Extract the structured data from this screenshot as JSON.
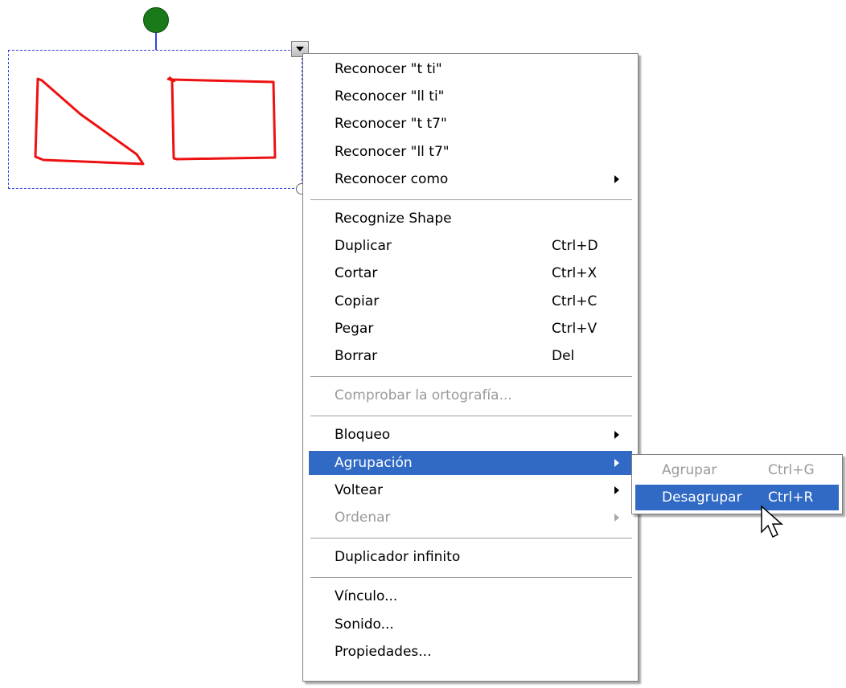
{
  "colors": {
    "highlight": "#316ac5",
    "disabled_text": "#9a9a9a",
    "ink_red": "#ee1111",
    "rotate_handle": "#1a7a1a",
    "selection": "#3344dd"
  },
  "canvas": {
    "selected_object": {
      "shapes": [
        "hand-drawn-triangle",
        "hand-drawn-rectangle"
      ],
      "handles": [
        "rotate-handle",
        "menu-dropdown-handle",
        "resize-handle"
      ]
    }
  },
  "context_menu": {
    "groups": [
      [
        {
          "label": "Reconocer \"t ti\""
        },
        {
          "label": "Reconocer \"ll ti\""
        },
        {
          "label": "Reconocer \"t t7\""
        },
        {
          "label": "Reconocer \"ll t7\""
        },
        {
          "label": "Reconocer como",
          "submenu": true
        }
      ],
      [
        {
          "label": "Recognize Shape"
        },
        {
          "label": "Duplicar",
          "shortcut": "Ctrl+D"
        },
        {
          "label": "Cortar",
          "shortcut": "Ctrl+X"
        },
        {
          "label": "Copiar",
          "shortcut": "Ctrl+C"
        },
        {
          "label": "Pegar",
          "shortcut": "Ctrl+V"
        },
        {
          "label": "Borrar",
          "shortcut": "Del"
        }
      ],
      [
        {
          "label": "Comprobar la ortografía...",
          "disabled": true
        }
      ],
      [
        {
          "label": "Bloqueo",
          "submenu": true
        },
        {
          "label": "Agrupación",
          "submenu": true,
          "highlighted": true
        },
        {
          "label": "Voltear",
          "submenu": true
        },
        {
          "label": "Ordenar",
          "submenu": true,
          "disabled": true
        }
      ],
      [
        {
          "label": "Duplicador infinito"
        }
      ],
      [
        {
          "label": "Vínculo..."
        },
        {
          "label": "Sonido..."
        },
        {
          "label": "Propiedades..."
        }
      ]
    ]
  },
  "submenu": {
    "items": [
      {
        "label": "Agrupar",
        "shortcut": "Ctrl+G",
        "disabled": true
      },
      {
        "label": "Desagrupar",
        "shortcut": "Ctrl+R",
        "highlighted": true
      }
    ]
  }
}
